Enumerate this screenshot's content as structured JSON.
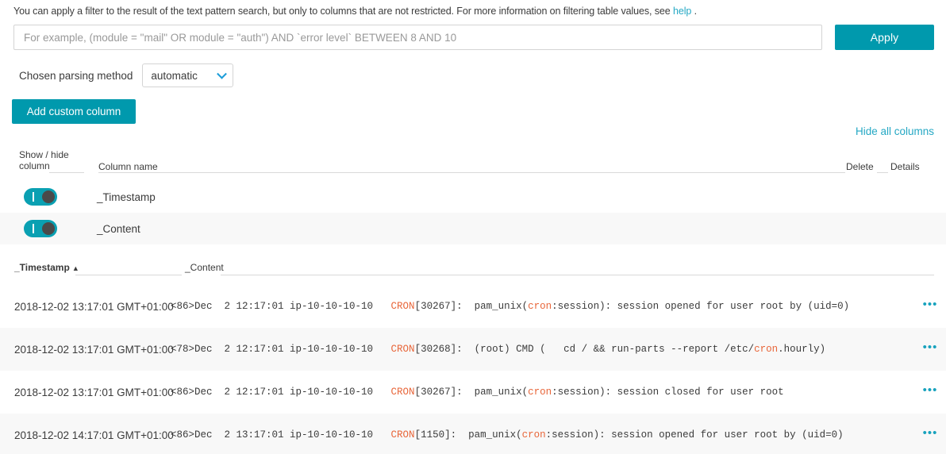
{
  "intro": {
    "text_before": "You can apply a filter to the result of the text pattern search, but only to columns that are not restricted. For more information on filtering table values, see ",
    "link_label": "help",
    "text_after": " ."
  },
  "filter": {
    "value": "",
    "placeholder": "For example, (module = \"mail\" OR module = \"auth\") AND `error level` BETWEEN 8 AND 10",
    "apply_label": "Apply"
  },
  "parsing": {
    "label": "Chosen parsing method",
    "selected": "automatic",
    "options": [
      "automatic"
    ]
  },
  "actions": {
    "add_custom_column": "Add custom column",
    "hide_all_columns": "Hide all columns"
  },
  "column_manager": {
    "headers": {
      "show_hide": "Show / hide\ncolumn",
      "show_hide_line1": "Show / hide",
      "show_hide_line2": "column",
      "column_name": "Column name",
      "delete": "Delete",
      "details": "Details"
    },
    "rows": [
      {
        "name": "_Timestamp",
        "visible": true
      },
      {
        "name": "_Content",
        "visible": true
      }
    ]
  },
  "data_table": {
    "headers": [
      {
        "label": "_Timestamp",
        "sorted": "asc",
        "sort_glyph": "▲"
      },
      {
        "label": "_Content",
        "sorted": "none",
        "sort_glyph": ""
      }
    ],
    "row_menu_glyph": "•••",
    "rows": [
      {
        "timestamp": "2018-12-02 13:17:01 GMT+01:00",
        "content_parts": [
          {
            "t": "<86>Dec  2 12:17:01 ip-10-10-10-10   ",
            "hl": false
          },
          {
            "t": "CRON",
            "hl": true
          },
          {
            "t": "[30267]:  pam_unix(",
            "hl": false
          },
          {
            "t": "cron",
            "hl": true
          },
          {
            "t": ":session): session opened for user root by (uid=0)",
            "hl": false
          }
        ]
      },
      {
        "timestamp": "2018-12-02 13:17:01 GMT+01:00",
        "content_parts": [
          {
            "t": "<78>Dec  2 12:17:01 ip-10-10-10-10   ",
            "hl": false
          },
          {
            "t": "CRON",
            "hl": true
          },
          {
            "t": "[30268]:  (root) CMD (   cd / && run-parts --report /etc/",
            "hl": false
          },
          {
            "t": "cron",
            "hl": true
          },
          {
            "t": ".hourly)",
            "hl": false
          }
        ]
      },
      {
        "timestamp": "2018-12-02 13:17:01 GMT+01:00",
        "content_parts": [
          {
            "t": "<86>Dec  2 12:17:01 ip-10-10-10-10   ",
            "hl": false
          },
          {
            "t": "CRON",
            "hl": true
          },
          {
            "t": "[30267]:  pam_unix(",
            "hl": false
          },
          {
            "t": "cron",
            "hl": true
          },
          {
            "t": ":session): session closed for user root",
            "hl": false
          }
        ]
      },
      {
        "timestamp": "2018-12-02 14:17:01 GMT+01:00",
        "content_parts": [
          {
            "t": "<86>Dec  2 13:17:01 ip-10-10-10-10   ",
            "hl": false
          },
          {
            "t": "CRON",
            "hl": true
          },
          {
            "t": "[1150]:  pam_unix(",
            "hl": false
          },
          {
            "t": "cron",
            "hl": true
          },
          {
            "t": ":session): session opened for user root by (uid=0)",
            "hl": false
          }
        ]
      }
    ]
  },
  "colors": {
    "accent_teal": "#0099ad",
    "link_blue": "#25a8c4",
    "highlight_orange": "#e8663a",
    "toggle_on": "#0aa0b2",
    "row_alt_bg": "#f8f8f8"
  }
}
